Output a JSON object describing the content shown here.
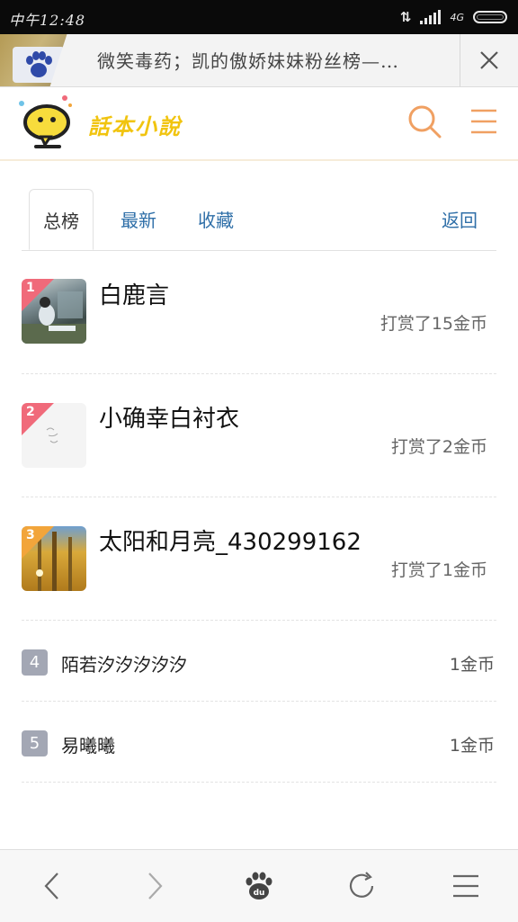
{
  "status_bar": {
    "carrier_time": "中午12:48",
    "network": "4G"
  },
  "browser_tab": {
    "title": "微笑毒药；凯的傲娇妹妹粉丝榜—…"
  },
  "site": {
    "logo_text": "話本小說"
  },
  "tabs": [
    {
      "label": "总榜",
      "active": true
    },
    {
      "label": "最新",
      "active": false
    },
    {
      "label": "收藏",
      "active": false
    }
  ],
  "back_label": "返回",
  "top_ranks": [
    {
      "rank": "1",
      "name": "白鹿言",
      "tip": "打赏了15金币"
    },
    {
      "rank": "2",
      "name": "小确幸白衬衣",
      "tip": "打赏了2金币"
    },
    {
      "rank": "3",
      "name": "太阳和月亮_430299162",
      "tip": "打赏了1金币"
    }
  ],
  "other_ranks": [
    {
      "rank": "4",
      "name": "陌若汐汐汐汐汐",
      "tip": "1金币"
    },
    {
      "rank": "5",
      "name": "易曦曦",
      "tip": "1金币"
    }
  ],
  "colors": {
    "accent": "#f0a062",
    "link": "#2f6fa8",
    "rank1": "#f06a7a",
    "rank3": "#f2a53b"
  }
}
